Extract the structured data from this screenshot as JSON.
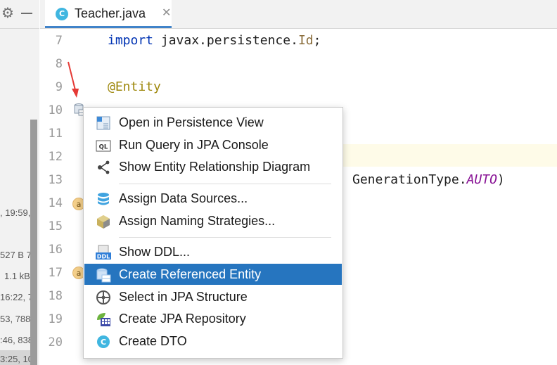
{
  "tab": {
    "icon_letter": "C",
    "filename": "Teacher.java",
    "close_glyph": "✕"
  },
  "left_strip": {
    "texts": [
      ", 19:59,",
      "527 B 7",
      "1.1 kB",
      "16:22, 7",
      "53, 788",
      ":46, 838",
      "3:25, 10"
    ]
  },
  "gutter": {
    "line_numbers": [
      "7",
      "8",
      "9",
      "10",
      "11",
      "12",
      "13",
      "14",
      "15",
      "16",
      "17",
      "18",
      "19",
      "20"
    ],
    "annotation_badge": "a"
  },
  "code": {
    "line7": {
      "kw": "import",
      "pkg": " javax.persistence.",
      "type": "Id",
      "end": ";"
    },
    "line9": "@Entity",
    "line13": {
      "text": "GenerationType.",
      "italic": "AUTO",
      "end": ")"
    }
  },
  "context_menu": {
    "items": [
      {
        "label": "Open in Persistence View",
        "icon": "persistence-view-icon"
      },
      {
        "label": "Run Query in JPA Console",
        "icon": "ql-console-icon"
      },
      {
        "label": "Show Entity Relationship Diagram",
        "icon": "diagram-icon"
      },
      {
        "label": "Assign Data Sources...",
        "icon": "datasource-icon"
      },
      {
        "label": "Assign Naming Strategies...",
        "icon": "naming-strategy-icon"
      },
      {
        "label": "Show DDL...",
        "icon": "ddl-icon"
      },
      {
        "label": "Create Referenced Entity",
        "icon": "referenced-entity-icon",
        "selected": true
      },
      {
        "label": "Select in JPA Structure",
        "icon": "jpa-structure-icon"
      },
      {
        "label": "Create JPA Repository",
        "icon": "jpa-repository-icon"
      },
      {
        "label": "Create DTO",
        "icon": "dto-icon"
      }
    ],
    "icon_texts": {
      "ql": "QL",
      "ddl": "DDL",
      "dto": "C"
    }
  },
  "colors": {
    "accent": "#2675bf",
    "tab_underline": "#4083c9",
    "keyword": "#0033b3",
    "annotation": "#9e880d",
    "arrow": "#e53935"
  }
}
